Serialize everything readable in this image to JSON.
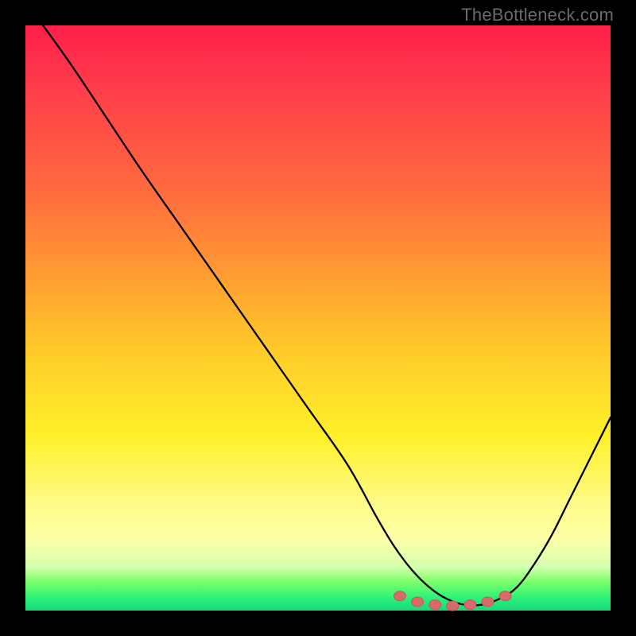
{
  "watermark": "TheBottleneck.com",
  "colors": {
    "curve": "#000000",
    "dot_fill": "#d86a6a",
    "dot_stroke": "#c45a5a",
    "gradient_top": "#ff1f4a",
    "gradient_bottom": "#18d87a",
    "frame": "#000000"
  },
  "chart_data": {
    "type": "line",
    "title": "",
    "xlabel": "",
    "ylabel": "",
    "xlim": [
      0,
      100
    ],
    "ylim": [
      0,
      100
    ],
    "x": [
      0,
      3,
      8,
      14,
      20,
      27,
      34,
      41,
      48,
      55,
      60,
      63,
      66,
      69,
      72,
      75,
      78,
      81,
      84,
      87,
      90,
      93,
      97,
      100
    ],
    "values": [
      104,
      100,
      93,
      84,
      75,
      65,
      55,
      45,
      35,
      25,
      16,
      11,
      7,
      4,
      2,
      1,
      1,
      2,
      4,
      8,
      13,
      19,
      27,
      33
    ],
    "series": [
      {
        "name": "bottleneck-curve",
        "x": [
          0,
          3,
          8,
          14,
          20,
          27,
          34,
          41,
          48,
          55,
          60,
          63,
          66,
          69,
          72,
          75,
          78,
          81,
          84,
          87,
          90,
          93,
          97,
          100
        ],
        "y": [
          104,
          100,
          93,
          84,
          75,
          65,
          55,
          45,
          35,
          25,
          16,
          11,
          7,
          4,
          2,
          1,
          1,
          2,
          4,
          8,
          13,
          19,
          27,
          33
        ]
      }
    ],
    "markers": [
      {
        "x": 64,
        "y": 2.5
      },
      {
        "x": 67,
        "y": 1.5
      },
      {
        "x": 70,
        "y": 1.0
      },
      {
        "x": 73,
        "y": 0.8
      },
      {
        "x": 76,
        "y": 1.0
      },
      {
        "x": 79,
        "y": 1.5
      },
      {
        "x": 82,
        "y": 2.5
      }
    ]
  }
}
